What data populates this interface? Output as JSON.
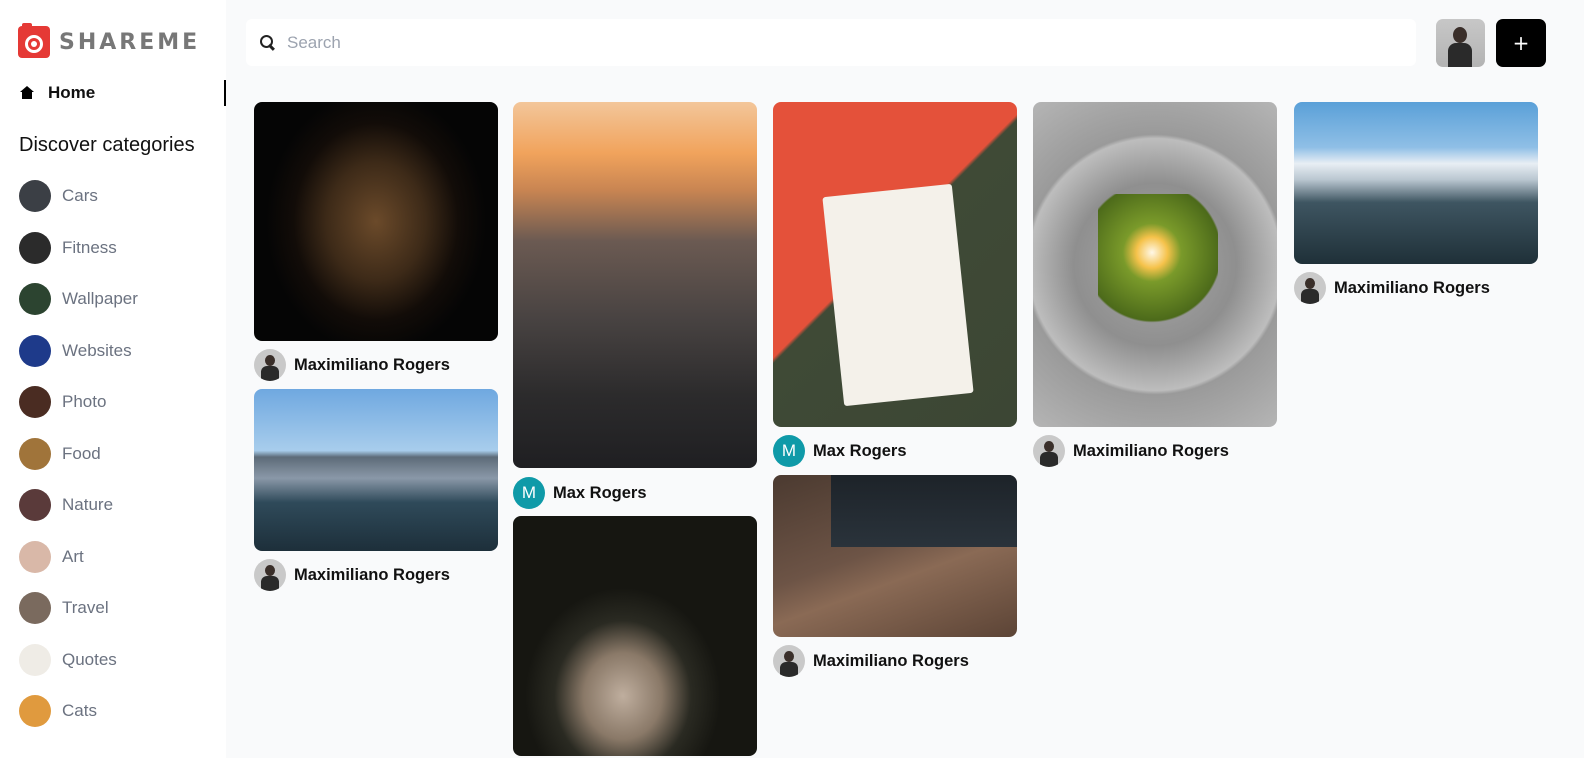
{
  "app": {
    "name": "SHAREME"
  },
  "sidebar": {
    "home_label": "Home",
    "discover_title": "Discover categories",
    "categories": [
      {
        "label": "Cars",
        "color": "#3b3f45"
      },
      {
        "label": "Fitness",
        "color": "#2b2b2b"
      },
      {
        "label": "Wallpaper",
        "color": "#2c4430"
      },
      {
        "label": "Websites",
        "color": "#1e3a8a"
      },
      {
        "label": "Photo",
        "color": "#4a2c22"
      },
      {
        "label": "Food",
        "color": "#a0743a"
      },
      {
        "label": "Nature",
        "color": "#5a3a3a"
      },
      {
        "label": "Art",
        "color": "#d9b8a8"
      },
      {
        "label": "Travel",
        "color": "#7a6a5e"
      },
      {
        "label": "Quotes",
        "color": "#efece6"
      },
      {
        "label": "Cats",
        "color": "#e09a3e"
      }
    ]
  },
  "search": {
    "placeholder": "Search",
    "value": ""
  },
  "header": {
    "add_label": "+"
  },
  "pins": {
    "p1": {
      "author": "Maximiliano Rogers",
      "image": "german-shepherd-dog"
    },
    "p2": {
      "author": "Maximiliano Rogers",
      "image": "city-harbor-skyline"
    },
    "p3": {
      "author": "Max Rogers",
      "avatar_letter": "M",
      "image": "aerial-city-sunset"
    },
    "p4": {
      "author": "",
      "image": "cat-with-crown"
    },
    "p5": {
      "author": "Max Rogers",
      "avatar_letter": "M",
      "image": "giraffe-watercolor"
    },
    "p6": {
      "author": "Maximiliano Rogers",
      "image": "laptop-coding"
    },
    "p7": {
      "author": "Maximiliano Rogers",
      "image": "avocado-toast-egg"
    },
    "p8": {
      "author": "Maximiliano Rogers",
      "image": "snowy-mountain"
    }
  }
}
